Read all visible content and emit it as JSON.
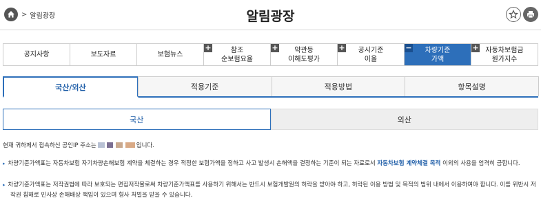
{
  "header": {
    "breadcrumb_label": "알림광장",
    "title": "알림광장"
  },
  "menu": [
    {
      "label": "공지사항",
      "plus": false,
      "active": false
    },
    {
      "label": "보도자료",
      "plus": false,
      "active": false
    },
    {
      "label": "보험뉴스",
      "plus": false,
      "active": false
    },
    {
      "label": "참조\n순보험요율",
      "plus": true,
      "active": false
    },
    {
      "label": "약관등\n이해도평가",
      "plus": true,
      "active": false
    },
    {
      "label": "공시기준\n이율",
      "plus": true,
      "active": false
    },
    {
      "label": "차량기준\n가액",
      "plus": true,
      "active": true
    },
    {
      "label": "자동차보험금\n원가지수",
      "plus": true,
      "active": false
    }
  ],
  "tabs": [
    "국산/외산",
    "적용기준",
    "적용방법",
    "항목설명"
  ],
  "subtabs": [
    "국산",
    "외산"
  ],
  "notices": {
    "ip_prefix": "현재 귀하께서 접속하신 공인IP 주소는",
    "ip_suffix": "입니다.",
    "note1_pre": "차량기준가액표는 자동차보험 자기차량손해보험 계약을 체결하는 경우 적정한 보험가액을 정하고 사고 발생시 손해액을 결정하는 기준이 되는 자료로서 ",
    "note1_highlight": "자동차보험 계약체결 목적",
    "note1_post": " 이외의 사용을 엄격히 금합니다.",
    "note2": "차량기준가액표는 저작권법에 따라 보호되는 편집저작물로써 차량기준가액표를 사용하기 위해서는 반드시 보험개발원의 허락을 받아야 하고, 허락된 이용 방법 및 목적의 범위 내에서 이용하여야 합니다. 이를 위반시 저작권 침해로 민사상 손해배상 책임이 있으며 형사 처벌을 받을 수 있습니다."
  },
  "colors": {
    "accent": "#2d6fba",
    "accent_dark": "#1f5ea8"
  },
  "icons": {
    "home": "home-icon",
    "favorite": "star-icon",
    "print": "print-icon",
    "expand": "plus-icon"
  }
}
